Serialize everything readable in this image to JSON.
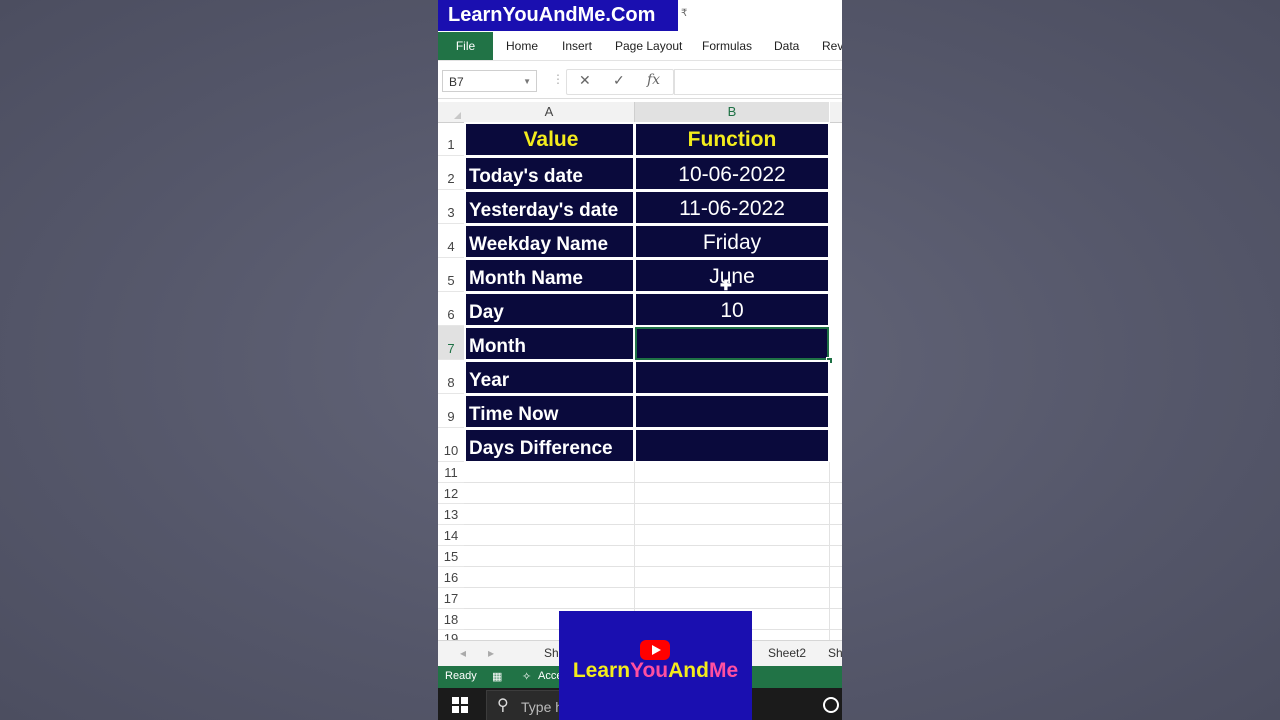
{
  "watermark": {
    "brand": "LearnYouAndMe.Com",
    "qa_arrow": "₹"
  },
  "ribbon": {
    "tabs": [
      "File",
      "Home",
      "Insert",
      "Page Layout",
      "Formulas",
      "Data",
      "Revi"
    ]
  },
  "formula_bar": {
    "name_box": "B7",
    "cancel": "✕",
    "enter": "✓",
    "fx": "fx",
    "value": ""
  },
  "columns": [
    "A",
    "B"
  ],
  "rows": [
    {
      "num": "1",
      "a": "Value",
      "b": "Function"
    },
    {
      "num": "2",
      "a": "Today's date",
      "b": "10-06-2022"
    },
    {
      "num": "3",
      "a": "Yesterday's date",
      "b": "11-06-2022"
    },
    {
      "num": "4",
      "a": "Weekday Name",
      "b": "Friday"
    },
    {
      "num": "5",
      "a": "Month Name",
      "b": "June"
    },
    {
      "num": "6",
      "a": "Day",
      "b": "10"
    },
    {
      "num": "7",
      "a": "Month",
      "b": ""
    },
    {
      "num": "8",
      "a": "Year",
      "b": ""
    },
    {
      "num": "9",
      "a": "Time Now",
      "b": ""
    },
    {
      "num": "10",
      "a": "Days Difference",
      "b": ""
    }
  ],
  "empty_rows": [
    "11",
    "12",
    "13",
    "14",
    "15",
    "16",
    "17",
    "18",
    "19"
  ],
  "sheet_tabs": [
    "Sh",
    "Sheet2",
    "Sh"
  ],
  "status": {
    "ready": "Ready",
    "accessibility": "Acce"
  },
  "taskbar": {
    "search_placeholder": "Type h"
  },
  "overlay": {
    "part1": "Learn",
    "part2": "You",
    "part3": "And",
    "part4": "Me"
  },
  "colors": {
    "brand_blue": "#1a0fb0",
    "excel_green": "#217346",
    "cell_dark": "#0a0a3c",
    "header_yellow": "#f3ec1c"
  }
}
